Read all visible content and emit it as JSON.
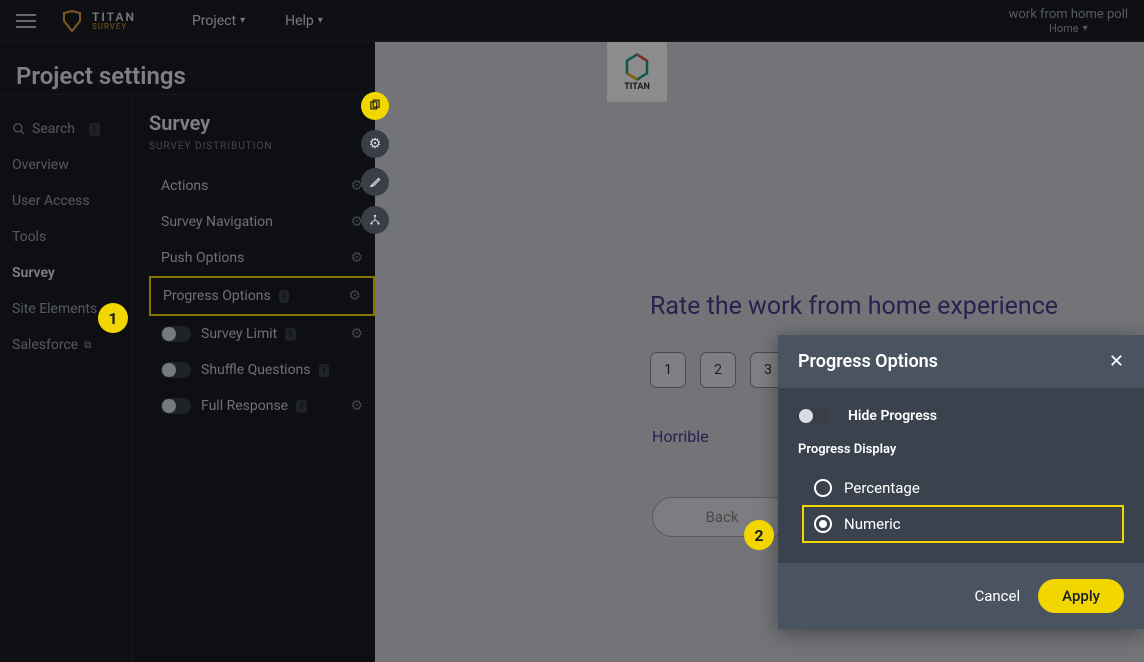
{
  "topbar": {
    "logo_title": "TITAN",
    "logo_sub": "SURVEY",
    "nav": {
      "project": "Project",
      "help": "Help"
    },
    "breadcrumb_title": "work from home poll",
    "breadcrumb_sub": "Home"
  },
  "page_title": "Project settings",
  "sidebar_a": {
    "search": "Search",
    "items": [
      "Overview",
      "User Access",
      "Tools",
      "Survey",
      "Site Elements",
      "Salesforce"
    ],
    "active_index": 3
  },
  "sidebar_b": {
    "title": "Survey",
    "subtitle": "SURVEY DISTRIBUTION",
    "items": [
      {
        "label": "Actions",
        "toggle": false,
        "gear": true,
        "badge": false
      },
      {
        "label": "Survey Navigation",
        "toggle": false,
        "gear": true,
        "badge": false
      },
      {
        "label": "Push Options",
        "toggle": false,
        "gear": true,
        "badge": false
      },
      {
        "label": "Progress Options",
        "toggle": false,
        "gear": true,
        "badge": true,
        "highlight": true
      },
      {
        "label": "Survey Limit",
        "toggle": true,
        "gear": true,
        "badge": true
      },
      {
        "label": "Shuffle Questions",
        "toggle": true,
        "gear": false,
        "badge": true
      },
      {
        "label": "Full Response",
        "toggle": true,
        "gear": true,
        "badge": true
      }
    ]
  },
  "canvas": {
    "logo_label": "TITAN",
    "question": "Rate the work from home experience",
    "ratings": [
      "1",
      "2",
      "3"
    ],
    "rating_label_low": "Horrible",
    "back": "Back"
  },
  "dialog": {
    "title": "Progress Options",
    "hide_progress": "Hide Progress",
    "section": "Progress Display",
    "options": {
      "percentage": "Percentage",
      "numeric": "Numeric"
    },
    "selected": "numeric",
    "cancel": "Cancel",
    "apply": "Apply"
  },
  "markers": {
    "one": "1",
    "two": "2"
  }
}
